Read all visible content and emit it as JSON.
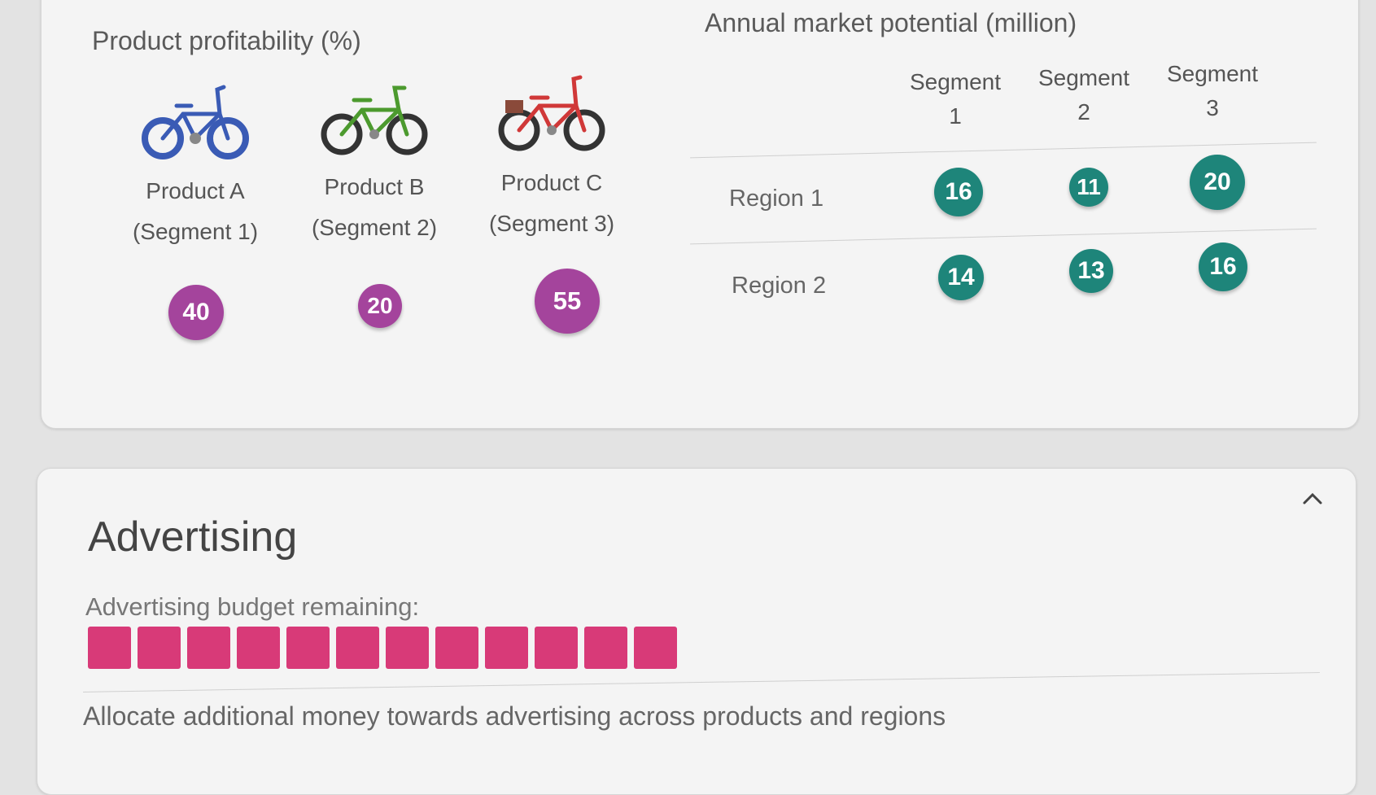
{
  "profitability": {
    "title": "Product profitability (%)",
    "products": [
      {
        "name": "Product A",
        "segment": "(Segment 1)",
        "value": "40",
        "bike_color": "#3a5bb5"
      },
      {
        "name": "Product B",
        "segment": "(Segment 2)",
        "value": "20",
        "bike_color": "#4c9a2e"
      },
      {
        "name": "Product C",
        "segment": "(Segment 3)",
        "value": "55",
        "bike_color": "#d03838"
      }
    ],
    "badge_color": "#a4449c"
  },
  "market": {
    "title": "Annual market potential (million)",
    "segments": [
      {
        "line1": "Segment",
        "line2": "1"
      },
      {
        "line1": "Segment",
        "line2": "2"
      },
      {
        "line1": "Segment",
        "line2": "3"
      }
    ],
    "regions": [
      {
        "label": "Region 1",
        "values": [
          "16",
          "11",
          "20"
        ]
      },
      {
        "label": "Region 2",
        "values": [
          "14",
          "13",
          "16"
        ]
      }
    ],
    "badge_color": "#1e857a"
  },
  "advertising": {
    "title": "Advertising",
    "budget_label": "Advertising budget remaining:",
    "budget_blocks_remaining": 12,
    "block_color": "#d83a78",
    "description": "Allocate additional money towards advertising across products and regions",
    "collapse_icon": "chevron-up-icon"
  }
}
